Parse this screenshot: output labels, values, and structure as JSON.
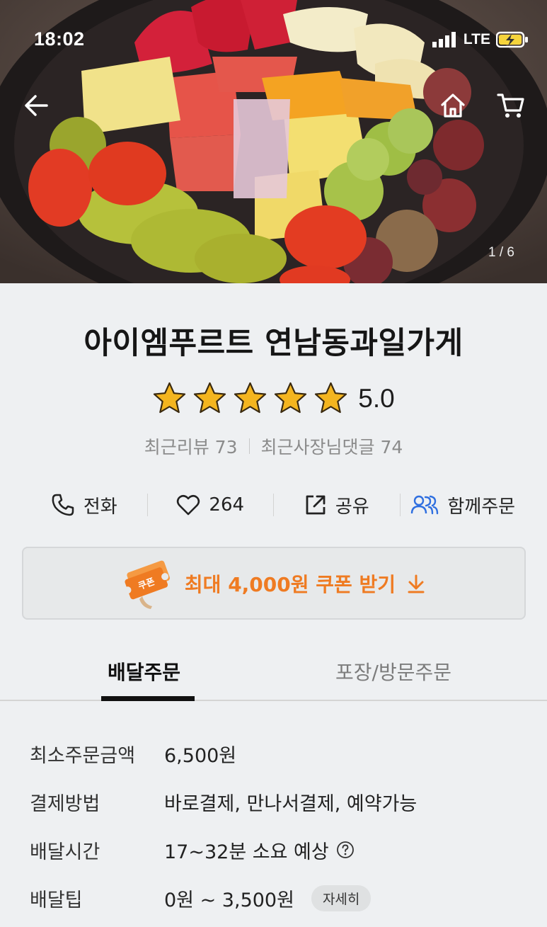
{
  "status_bar": {
    "time": "18:02",
    "network": "LTE"
  },
  "gallery": {
    "page_indicator": "1 / 6"
  },
  "nav": {
    "back_icon": "arrow-left-icon",
    "home_icon": "home-icon",
    "cart_icon": "cart-icon"
  },
  "store": {
    "name": "아이엠푸르트 연남동과일가게",
    "rating": "5.0",
    "stars_filled": 5,
    "recent_reviews": "최근리뷰 73",
    "owner_replies": "최근사장님댓글 74"
  },
  "actions": {
    "call": "전화",
    "likes": "264",
    "share": "공유",
    "group_order": "함께주문"
  },
  "coupon": {
    "label": "최대 4,000원 쿠폰 받기",
    "ticket_text": "쿠폰"
  },
  "tabs": {
    "delivery": "배달주문",
    "pickup": "포장/방문주문"
  },
  "info": {
    "rows": [
      {
        "label": "최소주문금액",
        "value": "6,500원"
      },
      {
        "label": "결제방법",
        "value": "바로결제, 만나서결제, 예약가능"
      },
      {
        "label": "배달시간",
        "value": "17~32분 소요 예상"
      },
      {
        "label": "배달팁",
        "value": "0원 ~ 3,500원"
      }
    ],
    "detail_button": "자세히"
  },
  "colors": {
    "accent_orange": "#ef7b22",
    "star_gold": "#f4b51f",
    "group_blue": "#2f6fe0"
  }
}
